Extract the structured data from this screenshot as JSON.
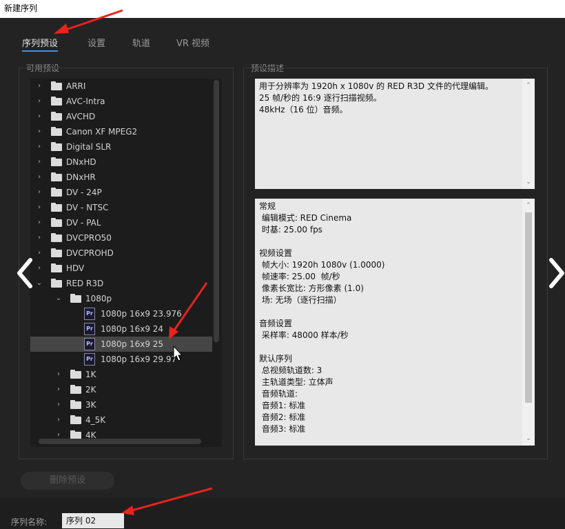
{
  "window": {
    "title": "新建序列"
  },
  "tabs": [
    {
      "label": "序列预设"
    },
    {
      "label": "设置"
    },
    {
      "label": "轨道"
    },
    {
      "label": "VR 视频"
    }
  ],
  "available_presets": {
    "label": "可用预设",
    "tree": [
      {
        "label": "ARRI",
        "type": "folder",
        "expanded": false
      },
      {
        "label": "AVC-Intra",
        "type": "folder",
        "expanded": false
      },
      {
        "label": "AVCHD",
        "type": "folder",
        "expanded": false
      },
      {
        "label": "Canon XF MPEG2",
        "type": "folder",
        "expanded": false
      },
      {
        "label": "Digital SLR",
        "type": "folder",
        "expanded": false
      },
      {
        "label": "DNxHD",
        "type": "folder",
        "expanded": false
      },
      {
        "label": "DNxHR",
        "type": "folder",
        "expanded": false
      },
      {
        "label": "DV - 24P",
        "type": "folder",
        "expanded": false
      },
      {
        "label": "DV - NTSC",
        "type": "folder",
        "expanded": false
      },
      {
        "label": "DV - PAL",
        "type": "folder",
        "expanded": false
      },
      {
        "label": "DVCPRO50",
        "type": "folder",
        "expanded": false
      },
      {
        "label": "DVCPROHD",
        "type": "folder",
        "expanded": false
      },
      {
        "label": "HDV",
        "type": "folder",
        "expanded": false
      },
      {
        "label": "RED R3D",
        "type": "folder",
        "expanded": true
      },
      {
        "label": "1080p",
        "type": "folder",
        "expanded": true
      },
      {
        "label": "1080p 16x9 23.976",
        "type": "preset"
      },
      {
        "label": "1080p 16x9 24",
        "type": "preset"
      },
      {
        "label": "1080p 16x9 25",
        "type": "preset",
        "selected": true
      },
      {
        "label": "1080p 16x9 29.97",
        "type": "preset"
      },
      {
        "label": "1K",
        "type": "folder",
        "expanded": false
      },
      {
        "label": "2K",
        "type": "folder",
        "expanded": false
      },
      {
        "label": "3K",
        "type": "folder",
        "expanded": false
      },
      {
        "label": "4_5K",
        "type": "folder",
        "expanded": false
      },
      {
        "label": "4K",
        "type": "folder",
        "expanded": false
      }
    ]
  },
  "preset_description": {
    "label": "预设描述",
    "summary": [
      "用于分辨率为 1920h x 1080v 的 RED R3D 文件的代理编辑。",
      "25 帧/秒的 16:9 逐行扫描视频。",
      "48kHz（16 位）音频。"
    ],
    "details": [
      "常规",
      " 编辑模式: RED Cinema",
      " 时基: 25.00 fps",
      "",
      "视频设置",
      " 帧大小: 1920h 1080v (1.0000)",
      " 帧速率: 25.00  帧/秒",
      " 像素长宽比: 方形像素 (1.0)",
      " 场: 无场（逐行扫描）",
      "",
      "音频设置",
      " 采样率: 48000 样本/秒",
      "",
      "默认序列",
      " 总视频轨道数: 3",
      " 主轨道类型: 立体声",
      " 音频轨道:",
      " 音频1: 标准",
      " 音频2: 标准",
      " 音频3: 标准"
    ]
  },
  "buttons": {
    "delete_preset": "删除预设"
  },
  "sequence_name": {
    "label": "序列名称:",
    "value": "序列 02"
  },
  "colors": {
    "dialog_bg": "#232323",
    "tab_underline": "#4a90e2",
    "annotation": "#e8231e"
  }
}
